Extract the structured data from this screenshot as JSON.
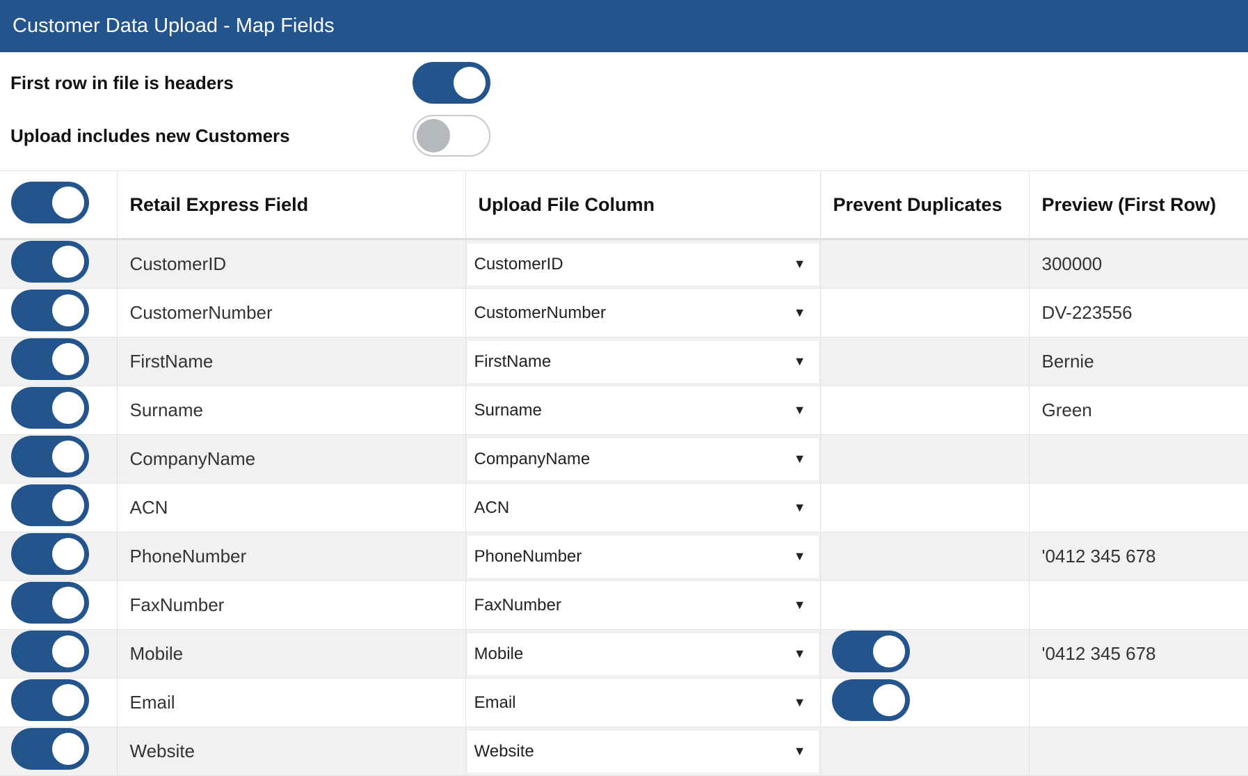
{
  "window": {
    "title": "Customer Data Upload - Map Fields"
  },
  "options": {
    "first_row_headers": {
      "label": "First row in file is headers",
      "on": true
    },
    "includes_new_customers": {
      "label": "Upload includes new Customers",
      "on": false
    }
  },
  "table": {
    "headers": {
      "field": "Retail Express Field",
      "column": "Upload File Column",
      "duplicates": "Prevent Duplicates",
      "preview": "Preview (First Row)"
    },
    "rows": [
      {
        "field": "CustomerID",
        "column": "CustomerID",
        "dup": null,
        "preview": "300000"
      },
      {
        "field": "CustomerNumber",
        "column": "CustomerNumber",
        "dup": null,
        "preview": "DV-223556"
      },
      {
        "field": "FirstName",
        "column": "FirstName",
        "dup": null,
        "preview": "Bernie"
      },
      {
        "field": "Surname",
        "column": "Surname",
        "dup": null,
        "preview": "Green"
      },
      {
        "field": "CompanyName",
        "column": "CompanyName",
        "dup": null,
        "preview": ""
      },
      {
        "field": "ACN",
        "column": "ACN",
        "dup": null,
        "preview": ""
      },
      {
        "field": "PhoneNumber",
        "column": "PhoneNumber",
        "dup": null,
        "preview": "'0412 345 678"
      },
      {
        "field": "FaxNumber",
        "column": "FaxNumber",
        "dup": null,
        "preview": ""
      },
      {
        "field": "Mobile",
        "column": "Mobile",
        "dup": true,
        "preview": "'0412 345 678"
      },
      {
        "field": "Email",
        "column": "Email",
        "dup": true,
        "preview": ""
      },
      {
        "field": "Website",
        "column": "Website",
        "dup": null,
        "preview": ""
      }
    ]
  },
  "colors": {
    "accent": "#23548c",
    "alt_row": "#f1f1f1"
  }
}
